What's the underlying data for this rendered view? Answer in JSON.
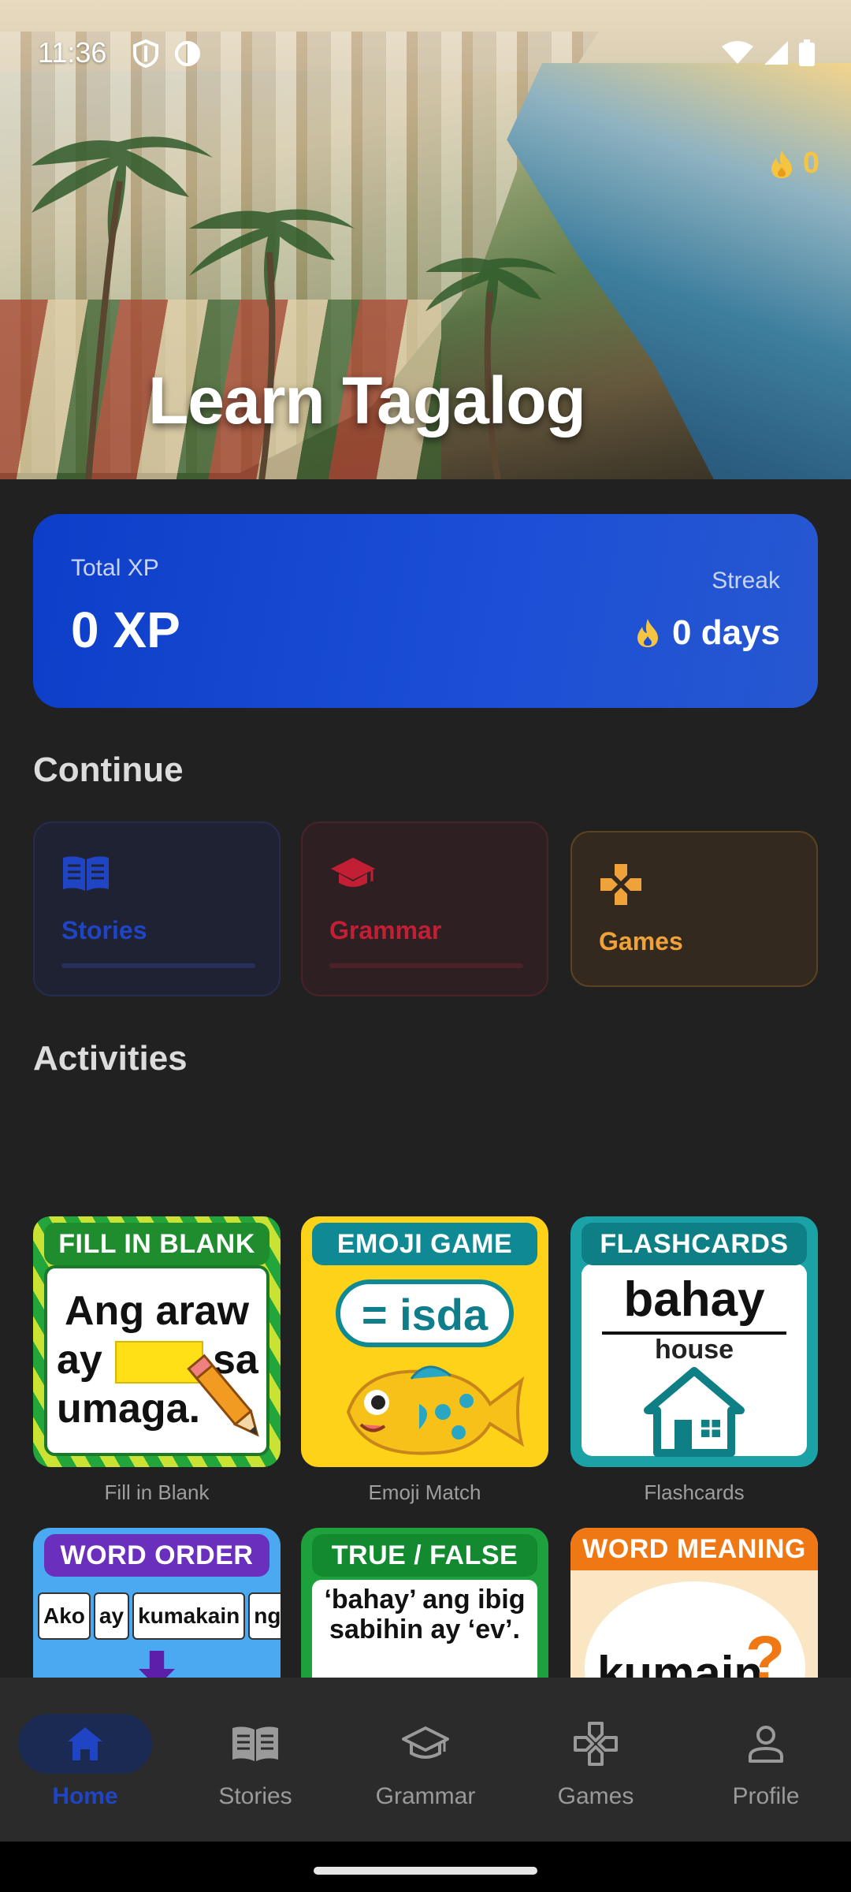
{
  "status_bar": {
    "time": "11:36"
  },
  "hero": {
    "title": "Learn Tagalog",
    "streak_count": "0"
  },
  "xp_card": {
    "xp_label": "Total XP",
    "xp_value": "0 XP",
    "streak_label": "Streak",
    "streak_value": "0 days"
  },
  "continue": {
    "title": "Continue",
    "cards": [
      {
        "label": "Stories",
        "icon": "book-icon",
        "color": "#1f45c4"
      },
      {
        "label": "Grammar",
        "icon": "graduation-cap-icon",
        "color": "#c21f35"
      },
      {
        "label": "Games",
        "icon": "gamepad-icon",
        "color": "#f0a23a"
      }
    ]
  },
  "activities": {
    "title": "Activities",
    "tiles": [
      {
        "caption": "Fill in Blank",
        "banner": "FILL IN BLANK",
        "line1": "Ang araw",
        "line2a": "ay",
        "line2b": "sa",
        "line3": "umaga."
      },
      {
        "caption": "Emoji Match",
        "banner": "EMOJI GAME",
        "bubble": "= isda"
      },
      {
        "caption": "Flashcards",
        "banner": "FLASHCARDS",
        "word": "bahay",
        "meaning": "house"
      },
      {
        "banner": "WORD ORDER",
        "words": [
          "Ako",
          "ay",
          "kumakain",
          "ngayon"
        ]
      },
      {
        "banner": "TRUE / FALSE",
        "question": "‘bahay’ ang ibig sabihin ay ‘ev’."
      },
      {
        "banner": "WORD MEANING",
        "word": "kumain",
        "mark": "?"
      }
    ]
  },
  "bottom_nav": {
    "items": [
      {
        "label": "Home",
        "icon": "home-icon",
        "active": true
      },
      {
        "label": "Stories",
        "icon": "book-icon",
        "active": false
      },
      {
        "label": "Grammar",
        "icon": "graduation-cap-icon",
        "active": false
      },
      {
        "label": "Games",
        "icon": "gamepad-icon",
        "active": false
      },
      {
        "label": "Profile",
        "icon": "person-icon",
        "active": false
      }
    ]
  },
  "colors": {
    "accent_blue": "#1f45c4",
    "grammar_red": "#c21f35",
    "games_orange": "#f0a23a",
    "background": "#212121",
    "flame": "#f5c542"
  }
}
